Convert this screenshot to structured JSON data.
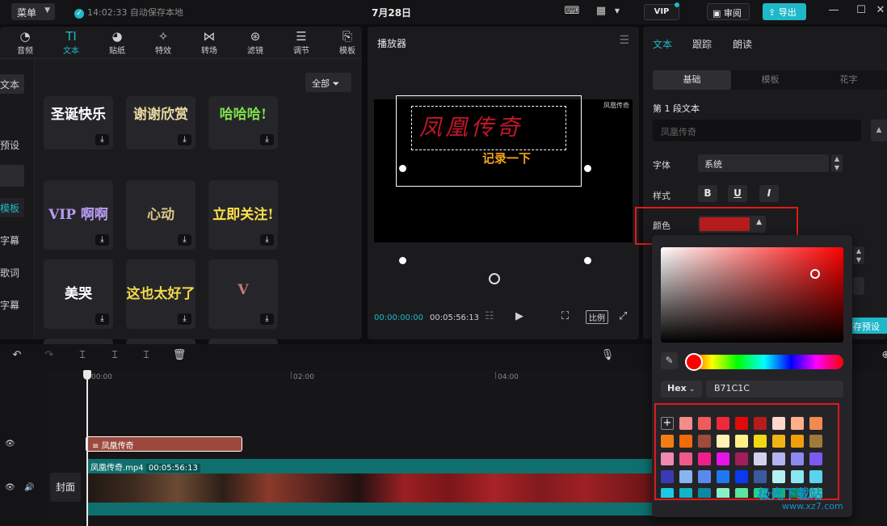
{
  "topbar": {
    "menu_label": "菜单",
    "save_status": "14:02:33 自动保存本地",
    "title": "7月28日",
    "vip_label": "VIP",
    "review_label": "审阅",
    "export_label": "导出"
  },
  "tool_tabs": [
    {
      "label": "音频"
    },
    {
      "label": "文本"
    },
    {
      "label": "贴纸"
    },
    {
      "label": "特效"
    },
    {
      "label": "转场"
    },
    {
      "label": "滤镜"
    },
    {
      "label": "调节"
    },
    {
      "label": "模板"
    }
  ],
  "side_list": [
    "文本",
    "预设",
    "模板",
    "字幕",
    "歌词",
    "字幕"
  ],
  "filter_button": "全部",
  "template_tiles": [
    {
      "art": "圣诞快乐",
      "color": "#ffffff"
    },
    {
      "art": "谢谢欣赏",
      "color": "#e8d9a0"
    },
    {
      "art": "哈哈哈!",
      "color": "#7ee04a"
    },
    {
      "art": "VIP 啊啊",
      "color": "#b89cf0"
    },
    {
      "art": "心动",
      "color": "#d9c88a"
    },
    {
      "art": "立即关注!",
      "color": "#ffe14a"
    },
    {
      "art": "美哭",
      "color": "#ffffff"
    },
    {
      "art": "这也太好了",
      "color": "#f2d84a"
    },
    {
      "art": "V",
      "color": "#c77a7a"
    },
    {
      "art": "",
      "color": "#888888"
    },
    {
      "art": "",
      "color": "#888888"
    },
    {
      "art": "",
      "color": "#888888"
    }
  ],
  "player": {
    "title": "播放器",
    "watermark": "凤凰传奇",
    "subtitle_text": "记录一下",
    "calligraphy_text": "凤凰传奇",
    "time_current": "00:00:00:00",
    "time_total": "00:05:56:13",
    "ratio_label": "比例"
  },
  "props": {
    "tabs": [
      "文本",
      "跟踪",
      "朗读"
    ],
    "segments": [
      "基础",
      "模板",
      "花字"
    ],
    "section_title": "第 1 段文本",
    "text_placeholder": "凤凰传奇",
    "font_label": "字体",
    "font_value": "系统",
    "style_label": "样式",
    "style_buttons": [
      "B",
      "U",
      "I"
    ],
    "color_label": "颜色",
    "color_value": "#b71c1c",
    "preset_button": "存预设"
  },
  "picker": {
    "hex_mode": "Hex",
    "hex_value": "B71C1C",
    "swatches": [
      [
        "#ffc1cc",
        "#f48b8b",
        "#f05a5a",
        "#f0283c",
        "#e00a0a",
        "#b71c1c",
        "#ffd6c9",
        "#ffb08a",
        "#f08a50"
      ],
      [
        "#f07e14",
        "#f06a0a",
        "#a04a3a",
        "#fff0b4",
        "#fff08a",
        "#f0d814",
        "#f0b414",
        "#f0a00a",
        "#a07a3a"
      ],
      [
        "#f08ab4",
        "#f05a8a",
        "#f01e8a",
        "#e614e6",
        "#a01e5a",
        "#d2d2f0",
        "#b4b4f0",
        "#8a8af0",
        "#7a5af0"
      ],
      [
        "#3a3ab4",
        "#8ab4f0",
        "#5a8af0",
        "#1e78f0",
        "#0a3af0",
        "#3a5aa0",
        "#b4f0f0",
        "#8ae6f0",
        "#5ad2f0"
      ],
      [
        "#1ec8e6",
        "#14b4c8",
        "#0a8aa0",
        "#8af0c8",
        "#5ae6a0",
        "#1ed28a",
        "#14b478",
        "#0a8a5a",
        "#3ac8a0"
      ]
    ]
  },
  "timeline": {
    "ticks": [
      "00:00",
      "02:00",
      "04:00"
    ],
    "text_clip_label": "凤凰传奇",
    "video_clip_name": "凤凰传奇.mp4",
    "video_clip_duration": "00:05:56:13",
    "cover_label": "封面"
  },
  "watermark_logo": {
    "text": "极光下载站",
    "sub": "www.xz7.com"
  }
}
